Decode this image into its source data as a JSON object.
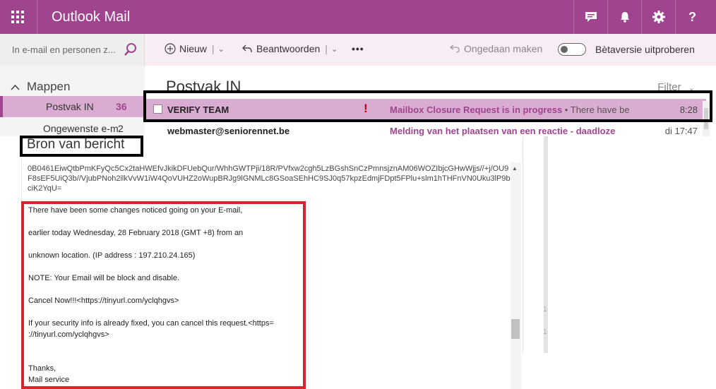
{
  "app": {
    "title": "Outlook Mail"
  },
  "topbar": {
    "icons": [
      "chat-icon",
      "bell-icon",
      "gear-icon",
      "help-icon"
    ],
    "help_glyph": "?"
  },
  "search": {
    "placeholder": "In e-mail en personen z..."
  },
  "toolbar": {
    "new_label": "Nieuw",
    "reply_label": "Beantwoorden",
    "more_label": "•••",
    "undo_label": "Ongedaan maken",
    "beta_label": "Bètaversie uitproberen"
  },
  "folders": {
    "heading": "Mappen",
    "items": [
      {
        "label": "Postvak IN",
        "count": "36"
      },
      {
        "label": "Ongewenste e-m",
        "count": "2"
      }
    ]
  },
  "message_list": {
    "title": "Postvak IN",
    "filter_label": "Filter",
    "rows": [
      {
        "from": "VERIFY TEAM",
        "subject": "Mailbox Closure Request is in progress",
        "preview": "There have be",
        "time": "8:28",
        "flag": "!"
      },
      {
        "from": "webmaster@seniorennet.be",
        "subject": "Melding van het plaatsen van een reactie - daadloze",
        "preview": "",
        "time": "di 17:47",
        "flag": ""
      }
    ]
  },
  "source_window": {
    "title": "Bron van bericht",
    "encoded_text": "0B0461EiwQtbPmKFyQc5Cx2taHWEfvJkikDFUebQur/WhhGWTPji/18R/PVfxw2cgh5LzBGshSnCzPmnsjznAM06WOZIbjcGHwWjjs//+j/OU9F8sEF5UiQ3b//VjubPNoh2ilkVvW1iW4QoVUHZ2oWupBRJg9lGNMLc8GSoaSEhHC9SJ0q57kpzEdmjFDpt5FPlu+slm1hTHFnVN0Uku3lP9bciK2YqU=",
    "body_lines": [
      "There have been some changes noticed going on your E-mail,",
      "earlier today Wednesday, 28 February 2018 (GMT +8) from an",
      "unknown location. (IP address : 197.210.24.165)",
      "NOTE:  Your Email  will be block and disable.",
      "Cancel Now!!!<https://tinyurl.com/yclqhgvs>",
      "If  your security info is already fixed, you can cancel this request.<https=",
      "://tinyurl.com/yclqhgvs>",
      "Thanks,",
      "Mail service"
    ],
    "side_glyphs": [
      "1",
      "1"
    ]
  },
  "colors": {
    "brand": "#a0448f",
    "selected_row": "#dbacd1",
    "flag": "#cc0000",
    "annotation_red": "#d4262c"
  }
}
